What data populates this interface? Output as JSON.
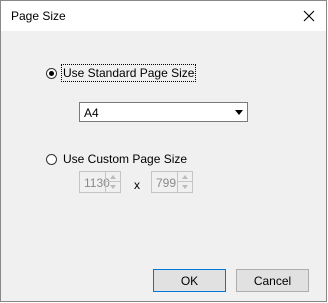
{
  "window": {
    "title": "Page Size"
  },
  "options": {
    "standard_label": "Use Standard Page Size",
    "custom_label": "Use Custom Page Size",
    "selected": "standard"
  },
  "standard": {
    "selected_size": "A4"
  },
  "custom": {
    "width": "1130",
    "height": "799",
    "separator": "x",
    "enabled": false
  },
  "buttons": {
    "ok": "OK",
    "cancel": "Cancel"
  },
  "icons": {
    "close": "close-icon",
    "dropdown": "chevron-down-icon",
    "spin_up": "spin-up-icon",
    "spin_down": "spin-down-icon"
  }
}
